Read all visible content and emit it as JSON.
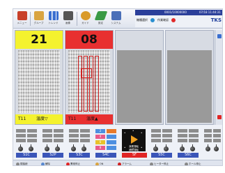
{
  "toolbar": {
    "buttons": [
      {
        "label": "メニュー",
        "icon": "house-icon",
        "color": "#c8402a"
      },
      {
        "label": "グループ",
        "icon": "clipboard-icon",
        "color": "#d9a441"
      },
      {
        "label": "トレンド",
        "icon": "chart-icon",
        "color": "#3a6fd0"
      },
      {
        "label": "画像",
        "icon": "monitor-icon",
        "color": "#556"
      },
      {
        "label": "ガイド",
        "icon": "magnifier-icon",
        "color": "#d99a2a"
      },
      {
        "label": "設定",
        "icon": "pencil-icon",
        "color": "#3a9a45"
      },
      {
        "label": "システム",
        "icon": "computer-icon",
        "color": "#4a6fb8"
      }
    ]
  },
  "info": {
    "number": "0001/10000000",
    "datetime": "07/18 11:44:31",
    "status_a": "機種選択",
    "status_b": "作業確認",
    "brand": "TKS",
    "dot_a_color": "#2a8fd0",
    "dot_b_color": "#e02a2a"
  },
  "quadrants": [
    {
      "header": "21",
      "header_color": "#f4f22e",
      "foot_t": "T11",
      "foot_w": "温度▽",
      "foot_color": "#f4f22e"
    },
    {
      "header": "08",
      "header_color": "#e83030",
      "foot_t": "T11",
      "foot_w": "温度▲",
      "foot_color": "#e83030"
    },
    {
      "header": "",
      "header_color": "#d7dbe3"
    },
    {
      "header": "",
      "header_color": "#d7dbe3"
    }
  ],
  "bottom_panels": [
    {
      "label": "S1C",
      "red": false
    },
    {
      "label": "S2P",
      "red": false
    },
    {
      "label": "S3C",
      "red": false
    },
    {
      "label": "S4C",
      "red": false
    },
    {
      "label": "SF",
      "red": true
    },
    {
      "label": "S5C",
      "red": false
    },
    {
      "label": "S6C",
      "red": false
    }
  ],
  "numbers": [
    "2",
    "4",
    "6",
    "8"
  ],
  "ctrl_labels": {
    "top": "漁業運転",
    "bottom": "補助運転"
  },
  "bottom_bar": [
    {
      "label": "閉接続",
      "color": "#888"
    },
    {
      "label": "解除",
      "color": "#5a8ad0"
    },
    {
      "label": "異常停止",
      "color": "#e02525"
    },
    {
      "label": "ON",
      "color": "#d9a441"
    },
    {
      "label": "アラーム",
      "color": "#d02020"
    },
    {
      "label": "ヒーター停止",
      "color": "#888"
    },
    {
      "label": "ホール停止",
      "color": "#888"
    }
  ]
}
